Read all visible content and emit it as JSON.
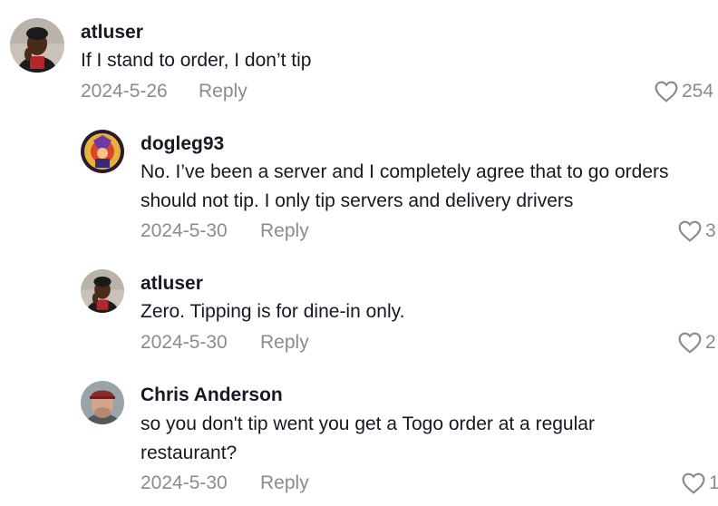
{
  "comments": [
    {
      "username": "atluser",
      "text": "If I stand to order, I don’t tip",
      "date": "2024-5-26",
      "reply_label": "Reply",
      "likes": "254",
      "avatar_icon": "user-avatar-photo"
    },
    {
      "username": "dogleg93",
      "text": "No. I’ve been a server and I completely agree that to go orders should not tip. I only tip servers and delivery drivers",
      "date": "2024-5-30",
      "reply_label": "Reply",
      "likes": "3",
      "avatar_icon": "user-avatar-illustration"
    },
    {
      "username": "atluser",
      "text": "Zero. Tipping is for dine-in only.",
      "date": "2024-5-30",
      "reply_label": "Reply",
      "likes": "2",
      "avatar_icon": "user-avatar-photo"
    },
    {
      "username": "Chris Anderson",
      "text": "so you don't tip went you get a Togo order at a regular restaurant?",
      "date": "2024-5-30",
      "reply_label": "Reply",
      "likes": "1",
      "avatar_icon": "user-avatar-photo"
    }
  ],
  "colors": {
    "text": "#161823",
    "secondary": "#8a8b91",
    "background": "#ffffff"
  }
}
